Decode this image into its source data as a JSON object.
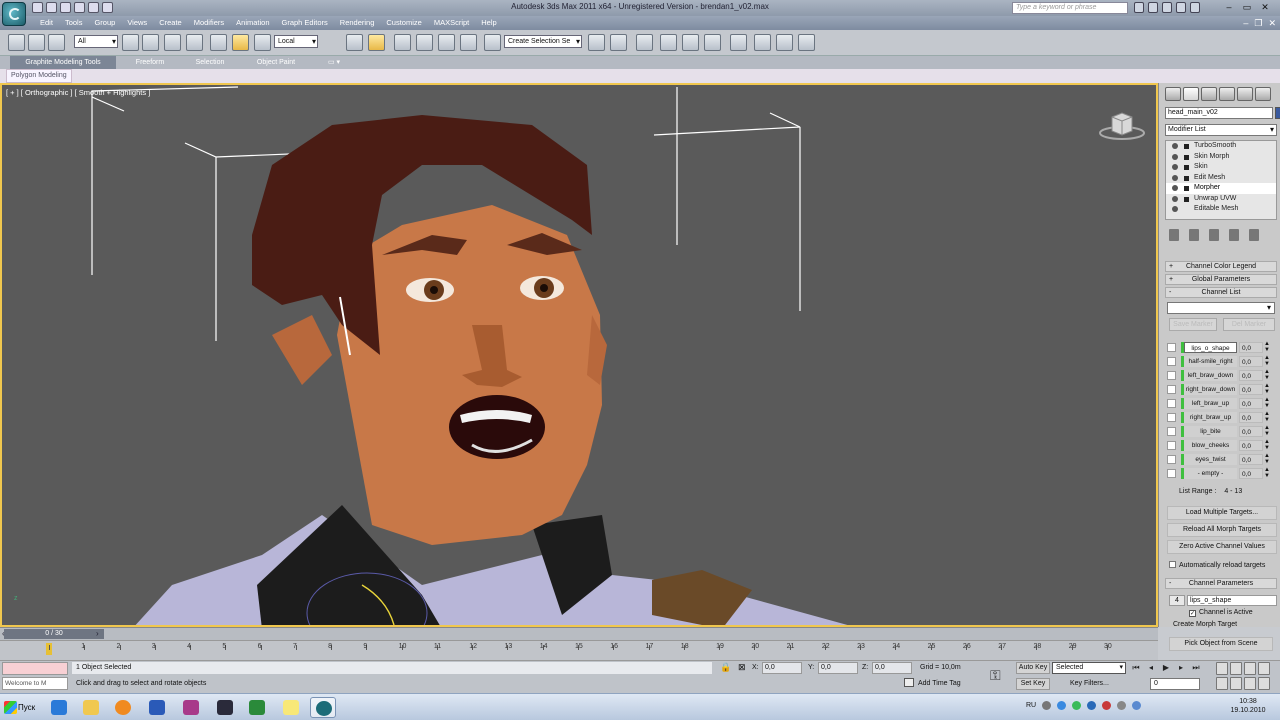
{
  "app": {
    "title": "Autodesk 3ds Max 2011 x64 - Unregistered Version - brendan1_v02.max",
    "help_search_placeholder": "Type a keyword or phrase"
  },
  "menu": [
    "Edit",
    "Tools",
    "Group",
    "Views",
    "Create",
    "Modifiers",
    "Animation",
    "Graph Editors",
    "Rendering",
    "Customize",
    "MAXScript",
    "Help"
  ],
  "toolbar": {
    "selection_filter": "All",
    "reference_coord": "Local",
    "named_selection": "Create Selection Se"
  },
  "ribbon": {
    "tabs": [
      "Graphite Modeling Tools",
      "Freeform",
      "Selection",
      "Object Paint"
    ],
    "panel": "Polygon Modeling"
  },
  "viewport": {
    "label": "[ + ] [ Orthographic ] [ Smooth + Highlights ]",
    "axis_label": "z"
  },
  "command_panel": {
    "object_name": "head_main_v02",
    "modifier_list_label": "Modifier List",
    "object_color": "#3a5a9e",
    "stack": [
      {
        "label": "TurboSmooth",
        "selected": false
      },
      {
        "label": "Skin Morph",
        "selected": false
      },
      {
        "label": "Skin",
        "selected": false
      },
      {
        "label": "Edit Mesh",
        "selected": false
      },
      {
        "label": "Morpher",
        "selected": true
      },
      {
        "label": "Unwrap UVW",
        "selected": false
      },
      {
        "label": "Editable Mesh",
        "selected": false
      }
    ],
    "rollouts": {
      "color_legend": "Channel Color Legend",
      "global_params": "Global Parameters",
      "channel_list": "Channel List"
    },
    "save_marker": "Save Marker",
    "del_marker": "Del Marker",
    "channels": [
      {
        "name": "lips_o_shape",
        "value": "0,0",
        "selected": true
      },
      {
        "name": "half-smile_right",
        "value": "0,0",
        "selected": false
      },
      {
        "name": "left_braw_down",
        "value": "0,0",
        "selected": false
      },
      {
        "name": "right_braw_down",
        "value": "0,0",
        "selected": false
      },
      {
        "name": "left_braw_up",
        "value": "0,0",
        "selected": false
      },
      {
        "name": "right_braw_up",
        "value": "0,0",
        "selected": false
      },
      {
        "name": "lip_bite",
        "value": "0,0",
        "selected": false
      },
      {
        "name": "blow_cheeks",
        "value": "0,0",
        "selected": false
      },
      {
        "name": "eyes_twist",
        "value": "0,0",
        "selected": false
      },
      {
        "name": "- empty -",
        "value": "0,0",
        "selected": false
      }
    ],
    "list_range_label": "List Range :",
    "list_range": "4 - 13",
    "buttons": {
      "load_multiple": "Load Multiple Targets...",
      "reload_all": "Reload All Morph Targets",
      "zero_active": "Zero Active Channel Values"
    },
    "auto_reload": "Automatically reload targets",
    "channel_params": {
      "title": "Channel Parameters",
      "number": "4",
      "name": "lips_o_shape",
      "active_label": "Channel is Active",
      "create_label": "Create Morph Target",
      "pick_button": "Pick Object from Scene"
    }
  },
  "timeline": {
    "position": "0 / 30",
    "ticks": [
      "0",
      "1",
      "2",
      "3",
      "4",
      "5",
      "6",
      "7",
      "8",
      "9",
      "10",
      "11",
      "12",
      "13",
      "14",
      "15",
      "16",
      "17",
      "18",
      "19",
      "20",
      "21",
      "22",
      "23",
      "24",
      "25",
      "26",
      "27",
      "28",
      "29",
      "30"
    ]
  },
  "status": {
    "selection": "1 Object Selected",
    "prompt": "Click and drag to select and rotate objects",
    "maxscript_prompt": "Welcome to M",
    "x_label": "X:",
    "x": "0,0",
    "y_label": "Y:",
    "y": "0,0",
    "z_label": "Z:",
    "z": "0,0",
    "grid": "Grid = 10,0m",
    "add_time_tag": "Add Time Tag",
    "auto_key": "Auto Key",
    "set_key": "Set Key",
    "selected_set": "Selected",
    "key_filters": "Key Filters...",
    "frame": "0"
  },
  "taskbar": {
    "start": "Пуск",
    "lang": "RU",
    "time": "10:38",
    "date": "19.10.2010"
  }
}
